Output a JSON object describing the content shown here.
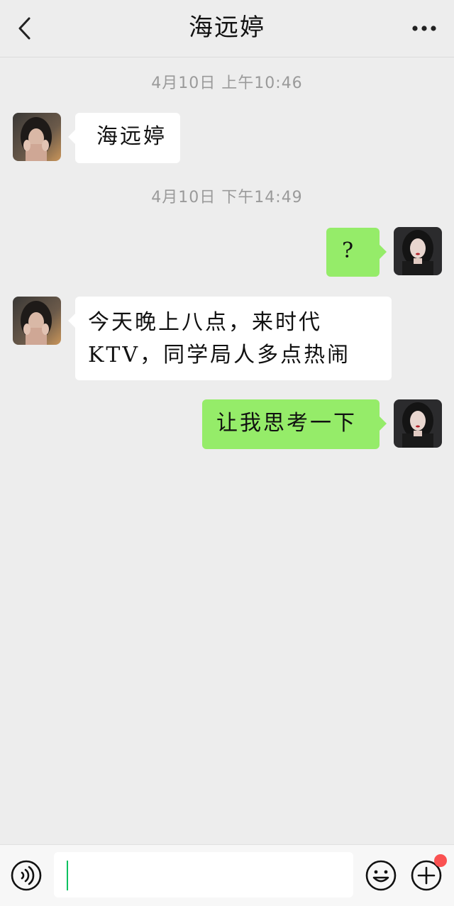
{
  "header": {
    "title": "海远婷",
    "back_icon": "chevron-left-icon",
    "more_icon": "more-dots-icon"
  },
  "messages": [
    {
      "type": "timestamp",
      "text": "4月10日 上午10:46"
    },
    {
      "type": "message",
      "side": "left",
      "text": "海远婷"
    },
    {
      "type": "timestamp",
      "text": "4月10日 下午14:49"
    },
    {
      "type": "message",
      "side": "right",
      "text": "?"
    },
    {
      "type": "message",
      "side": "left",
      "lines": [
        "今天晚上八点，来时代",
        "KTV，同学局人多点热闹"
      ]
    },
    {
      "type": "message",
      "side": "right",
      "text": "让我思考一下"
    }
  ],
  "input_bar": {
    "voice_icon": "voice-icon",
    "emoji_icon": "emoji-icon",
    "plus_icon": "plus-icon",
    "input_value": ""
  },
  "colors": {
    "background": "#ededed",
    "bubble_self": "#95ec69",
    "bubble_other": "#ffffff",
    "timestamp": "#9a9a9a",
    "notification_dot": "#fa5151",
    "cursor": "#07c160"
  }
}
